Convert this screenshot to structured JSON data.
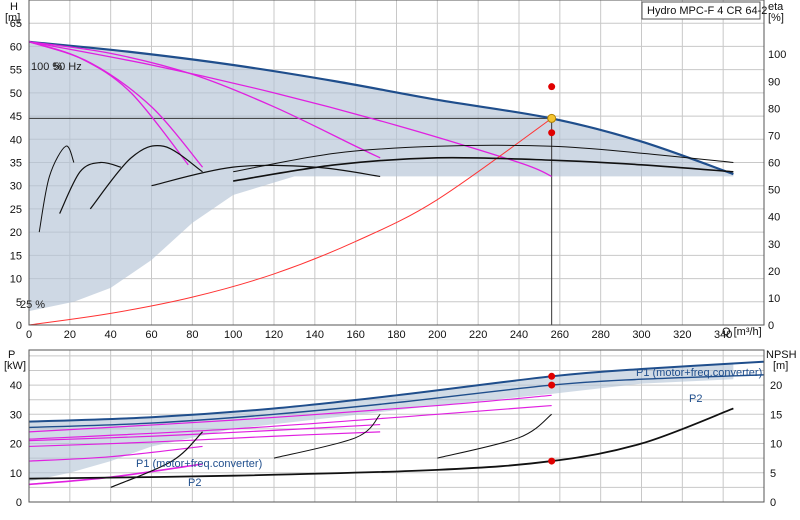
{
  "title": "Hydro MPC-F 4 CR 64-2",
  "chart_data": [
    {
      "type": "line",
      "title": "Hydro MPC-F 4 CR 64-2",
      "xlabel": "Q [m³/h]",
      "ylabel": "H [m]",
      "ylabel_name": "H",
      "ylabel_unit": "[m]",
      "ylabel2": "eta [%]",
      "ylabel2_name": "eta",
      "ylabel2_unit": "[%]",
      "xlim": [
        0,
        360
      ],
      "ylim": [
        0,
        70
      ],
      "y2lim": [
        0,
        120
      ],
      "x_ticks": [
        "0",
        "20",
        "40",
        "60",
        "80",
        "100",
        "120",
        "140",
        "160",
        "180",
        "200",
        "220",
        "240",
        "260",
        "280",
        "300",
        "320",
        "340"
      ],
      "y_ticks": [
        "0",
        "5",
        "10",
        "15",
        "20",
        "25",
        "30",
        "35",
        "40",
        "45",
        "50",
        "55",
        "60",
        "65"
      ],
      "y2_ticks": [
        "0",
        "10",
        "20",
        "30",
        "40",
        "50",
        "60",
        "70",
        "80",
        "90",
        "100"
      ],
      "grid": true,
      "annotations": [
        "100 %",
        "50 Hz",
        "25 %"
      ],
      "duty_point": {
        "Q": 256,
        "H": 44.5,
        "eta_points": [
          88,
          71
        ]
      },
      "series": [
        {
          "style": "head-100",
          "x": [
            0,
            50,
            100,
            150,
            200,
            256,
            300,
            345
          ],
          "y": [
            61,
            58.8,
            56,
            52.5,
            48.5,
            44.5,
            39.5,
            32.5
          ]
        },
        {
          "style": "head-3pump",
          "x": [
            0,
            40,
            80,
            120,
            160,
            172
          ],
          "y": [
            61,
            58.5,
            54,
            47,
            38.5,
            36
          ]
        },
        {
          "style": "head-2pump",
          "x": [
            0,
            30,
            60,
            85
          ],
          "y": [
            61,
            56.5,
            47,
            34
          ]
        },
        {
          "style": "head-1pump",
          "x": [
            0,
            25,
            50,
            78
          ],
          "y": [
            61,
            57.5,
            50,
            34.5
          ]
        },
        {
          "style": "head-4pump-min",
          "x": [
            0,
            60,
            120,
            180,
            240,
            256
          ],
          "y": [
            61,
            56,
            50,
            43,
            35,
            32
          ]
        },
        {
          "style": "system-curve",
          "x": [
            0,
            40,
            80,
            120,
            160,
            200,
            256
          ],
          "y": [
            0,
            2.5,
            6,
            11,
            18,
            27,
            44.5
          ]
        },
        {
          "style": "eta-4",
          "x": [
            100,
            150,
            200,
            256,
            300,
            345
          ],
          "y": [
            31,
            34.5,
            36,
            35.5,
            34.5,
            33
          ]
        },
        {
          "style": "eta-4b",
          "x": [
            100,
            150,
            200,
            256,
            300,
            345
          ],
          "y": [
            33,
            37,
            38.5,
            38.5,
            37,
            35
          ]
        },
        {
          "style": "eta-3",
          "x": [
            60,
            100,
            140,
            172
          ],
          "y": [
            30,
            34,
            34,
            32
          ]
        },
        {
          "style": "eta-2",
          "x": [
            30,
            50,
            66,
            85
          ],
          "y": [
            25,
            36,
            38.5,
            33
          ]
        },
        {
          "style": "eta-1",
          "x": [
            15,
            25,
            35,
            45
          ],
          "y": [
            24,
            33,
            35,
            34
          ]
        },
        {
          "style": "eta-small",
          "x": [
            5,
            10,
            18,
            22
          ],
          "y": [
            20,
            32,
            38.5,
            35
          ]
        }
      ]
    },
    {
      "type": "line",
      "ylabel": "P [kW]",
      "ylabel_name": "P",
      "ylabel_unit": "[kW]",
      "ylabel2": "NPSH [m]",
      "ylabel2_name": "NPSH",
      "ylabel2_unit": "[m]",
      "xlim": [
        0,
        360
      ],
      "ylim": [
        0,
        52
      ],
      "y2lim": [
        0,
        26
      ],
      "y_ticks": [
        "0",
        "10",
        "20",
        "30",
        "40"
      ],
      "y2_ticks": [
        "0",
        "5",
        "10",
        "15",
        "20"
      ],
      "grid": true,
      "series_labels": [
        "P1 (motor+freq.converter)",
        "P2",
        "P1 (motor+freq.converter)",
        "P2"
      ],
      "power_points": [
        43,
        40
      ],
      "npsh_point": 7,
      "series": [
        {
          "style": "p1-4pump",
          "x": [
            0,
            60,
            120,
            180,
            256,
            300,
            360
          ],
          "y": [
            27.5,
            29,
            32,
            36.5,
            43,
            45.5,
            48
          ]
        },
        {
          "style": "p2-4pump",
          "x": [
            0,
            60,
            120,
            180,
            256,
            300,
            360
          ],
          "y": [
            25.5,
            27,
            30,
            34,
            40,
            42,
            43.5
          ]
        },
        {
          "style": "p-3pump",
          "x": [
            0,
            60,
            120,
            172
          ],
          "y": [
            21,
            22.5,
            24.5,
            26.5
          ]
        },
        {
          "style": "p-3pumpb",
          "x": [
            0,
            60,
            120,
            172
          ],
          "y": [
            19,
            20.5,
            22.5,
            24
          ]
        },
        {
          "style": "p-magenta-top",
          "x": [
            0,
            100,
            200,
            256
          ],
          "y": [
            24,
            28,
            33,
            36.5
          ]
        },
        {
          "style": "p-magenta-mid",
          "x": [
            0,
            100,
            200,
            256
          ],
          "y": [
            21.5,
            25,
            30,
            33
          ]
        },
        {
          "style": "p-2pump",
          "x": [
            0,
            40,
            85
          ],
          "y": [
            14,
            15.5,
            19
          ]
        },
        {
          "style": "p-1pump",
          "x": [
            0,
            40,
            85
          ],
          "y": [
            6,
            8.5,
            13
          ]
        },
        {
          "style": "npsh-4pump",
          "x": [
            0,
            100,
            200,
            256,
            300,
            345
          ],
          "y": [
            4,
            4.5,
            5.5,
            7,
            10,
            16
          ]
        },
        {
          "style": "npsh-3pump",
          "x": [
            120,
            160,
            172
          ],
          "y": [
            7.5,
            11,
            15
          ]
        },
        {
          "style": "npsh-2pump",
          "x": [
            200,
            240,
            256
          ],
          "y": [
            7.5,
            11,
            15
          ]
        },
        {
          "style": "npsh-1pump",
          "x": [
            40,
            70,
            85
          ],
          "y": [
            2.5,
            7,
            12
          ]
        }
      ]
    }
  ]
}
